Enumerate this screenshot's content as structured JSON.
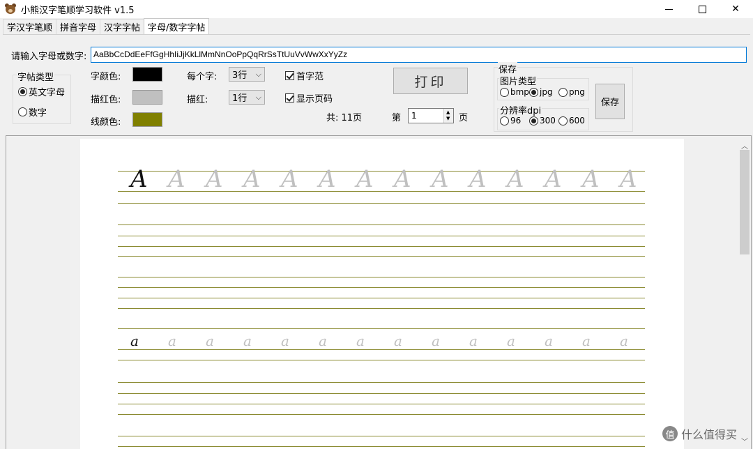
{
  "window": {
    "title": "小熊汉字笔顺学习软件 v1.5",
    "close_glyph": "✕"
  },
  "tabs": [
    {
      "label": "学汉字笔顺"
    },
    {
      "label": "拼音字母"
    },
    {
      "label": "汉字字帖"
    },
    {
      "label": "字母/数字字帖"
    }
  ],
  "form": {
    "input_label": "请输入字母或数字:",
    "input_value": "AaBbCcDdEeFfGgHhIiJjKkLlMmNnOoPpQqRrSsTtUuVvWwXxYyZz",
    "type_group": {
      "title": "字帖类型",
      "options": [
        {
          "label": "英文字母",
          "selected": true
        },
        {
          "label": "数字",
          "selected": false
        }
      ]
    },
    "colors": {
      "char_label": "字颜色:",
      "char_color": "#000000",
      "trace_label": "描红色:",
      "trace_color": "#c0c0c0",
      "line_label": "线颜色:",
      "line_color": "#808000"
    },
    "per_char": {
      "label": "每个字:",
      "value": "3行"
    },
    "trace_rows": {
      "label": "描红:",
      "value": "1行"
    },
    "first_model": {
      "label": "首字范",
      "checked": true
    },
    "show_page": {
      "label": "显示页码",
      "checked": true
    },
    "total": "共: 11页",
    "print_label": "打印",
    "page_prefix": "第",
    "page_value": "1",
    "page_suffix": "页"
  },
  "save": {
    "title": "保存",
    "image_type": {
      "title": "图片类型",
      "options": [
        {
          "label": "bmp",
          "selected": false
        },
        {
          "label": "jpg",
          "selected": true
        },
        {
          "label": "png",
          "selected": false
        }
      ]
    },
    "dpi": {
      "title": "分辨率dpi",
      "options": [
        {
          "label": "96",
          "selected": false
        },
        {
          "label": "300",
          "selected": true
        },
        {
          "label": "600",
          "selected": false
        }
      ]
    },
    "button_label": "保存"
  },
  "preview": {
    "row1_model": "A",
    "row1_trace": "A",
    "row2_model": "a",
    "row2_trace": "a"
  },
  "watermark": {
    "icon": "值",
    "text": "什么值得买"
  }
}
